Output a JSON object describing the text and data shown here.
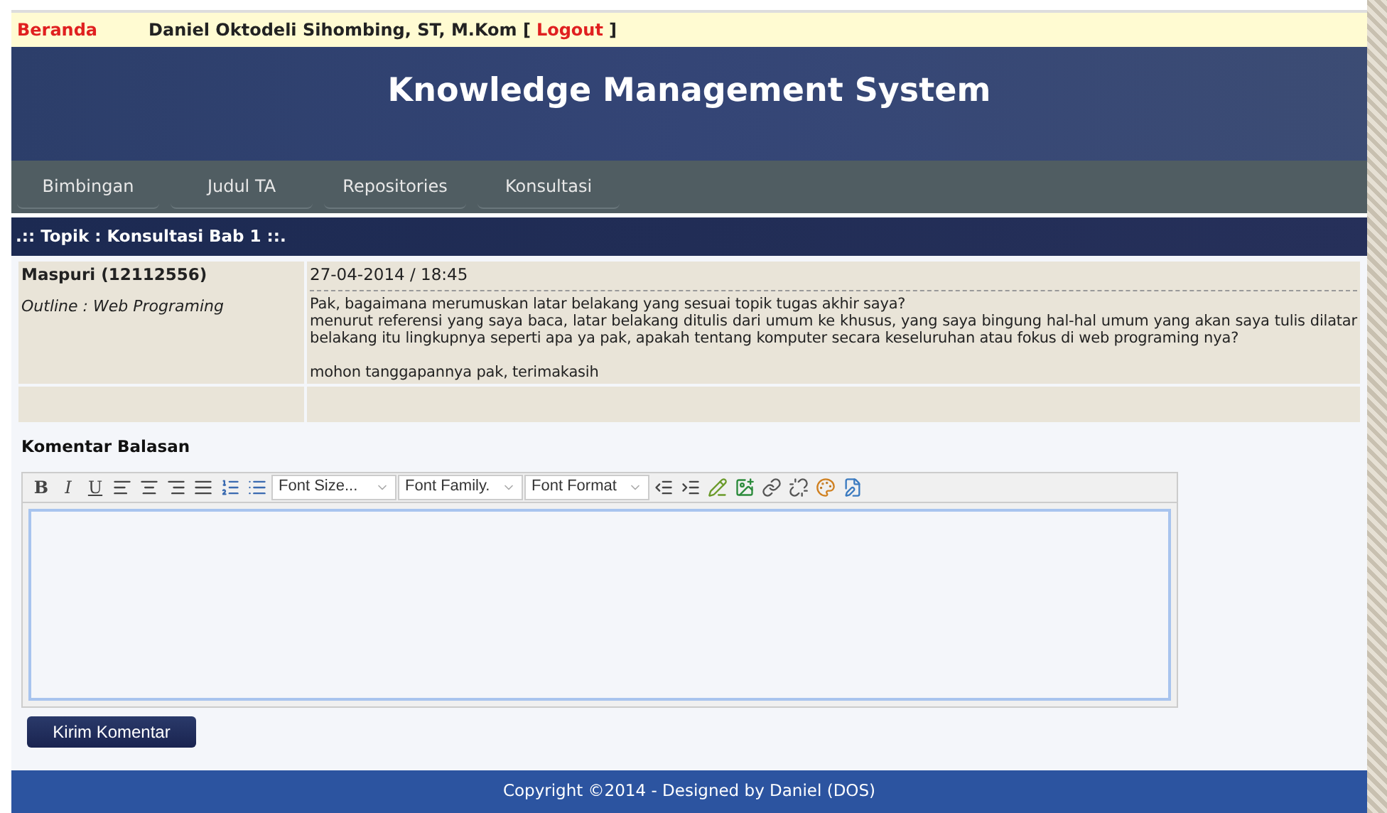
{
  "topbar": {
    "home_link": "Beranda",
    "user": "Daniel Oktodeli Sihombing, ST, M.Kom [",
    "logout_link": "Logout",
    "user_end": "]"
  },
  "header": {
    "title": "Knowledge Management System"
  },
  "nav": [
    "Bimbingan",
    "Judul TA",
    "Repositories",
    "Konsultasi"
  ],
  "topic_bar": ".:: Topik : Konsultasi Bab 1 ::.",
  "post": {
    "author": "Maspuri (12112556)",
    "outline": "Outline : Web Programing",
    "timestamp": "27-04-2014 / 18:45",
    "paragraphs": [
      "Pak, bagaimana merumuskan latar belakang yang sesuai topik tugas akhir saya?\nmenurut referensi yang saya baca, latar belakang ditulis dari umum ke khusus, yang saya bingung hal-hal umum yang akan saya tulis dilatar belakang itu lingkupnya seperti apa ya pak, apakah tentang komputer secara keseluruhan atau fokus di web programing nya?",
      "mohon tanggapannya pak, terimakasih"
    ]
  },
  "reply": {
    "label": "Komentar Balasan",
    "toolbar": [
      {
        "kind": "bold",
        "label": "B"
      },
      {
        "kind": "italic",
        "label": "I"
      },
      {
        "kind": "underline",
        "label": "U"
      },
      {
        "kind": "alignleft"
      },
      {
        "kind": "aligncenter"
      },
      {
        "kind": "alignright"
      },
      {
        "kind": "justify"
      },
      {
        "kind": "numbered"
      },
      {
        "kind": "bulleted"
      },
      {
        "kind": "select",
        "label": "Font Size..."
      },
      {
        "kind": "select",
        "label": "Font Family."
      },
      {
        "kind": "select",
        "label": "Font Format"
      },
      {
        "kind": "outdent"
      },
      {
        "kind": "indent"
      },
      {
        "kind": "edit"
      },
      {
        "kind": "image"
      },
      {
        "kind": "link"
      },
      {
        "kind": "unlink"
      },
      {
        "kind": "palette"
      },
      {
        "kind": "source"
      }
    ],
    "submit": "Kirim Komentar"
  },
  "footer": "Copyright ©2014 - Designed by Daniel (DOS)"
}
